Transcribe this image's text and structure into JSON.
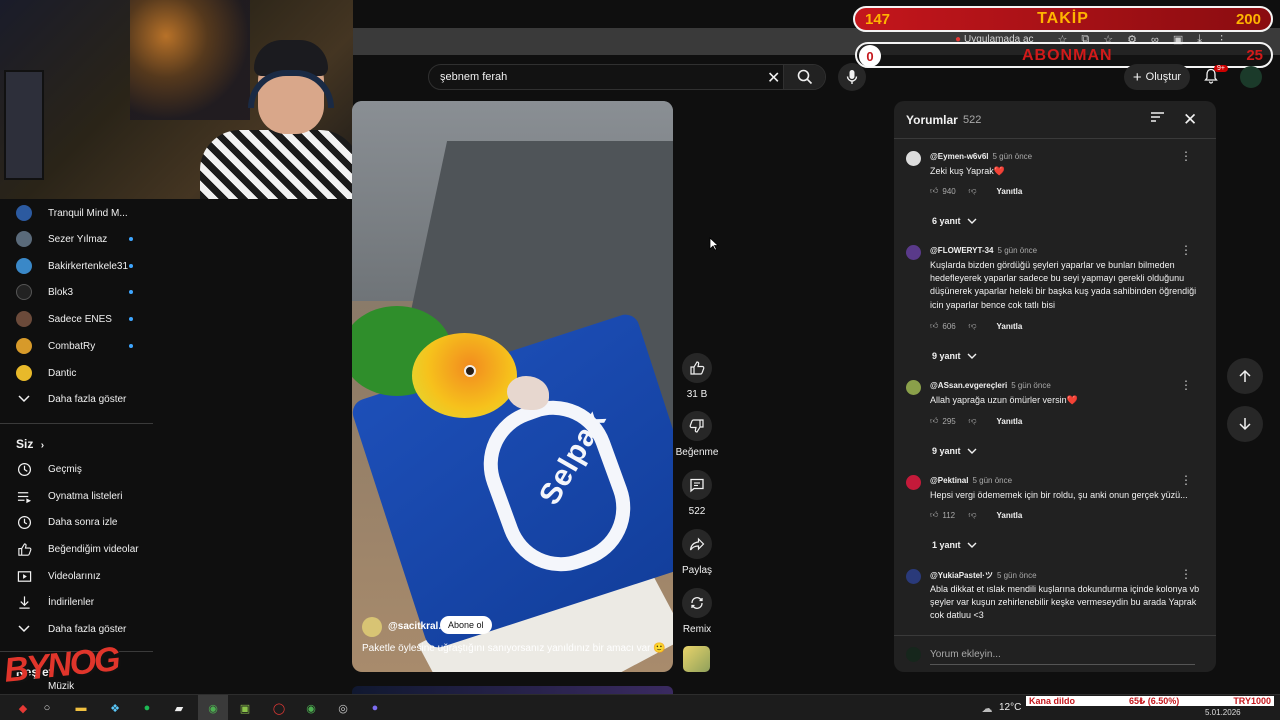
{
  "overlay": {
    "follow_current": "147",
    "follow_label": "TAKİP",
    "follow_goal": "200",
    "sub_current": "0",
    "sub_label": "ABONMAN",
    "sub_goal": "25",
    "logo_text": "BYNOG"
  },
  "browser": {
    "app_open_label": "Uygulamada aç"
  },
  "search": {
    "query": "şebnem ferah"
  },
  "header": {
    "create_label": "Oluştur",
    "notif_count": "9+"
  },
  "sidebar": {
    "subscriptions": [
      {
        "label": "Tranquil Mind M...",
        "color": "#2c5aa0",
        "live": false
      },
      {
        "label": "Sezer Yılmaz",
        "color": "#5a6a7a",
        "live": true
      },
      {
        "label": "Bakirkertenkele31",
        "color": "#3a88c8",
        "live": true
      },
      {
        "label": "Blok3",
        "color": "#222222",
        "live": true
      },
      {
        "label": "Sadece ENES",
        "color": "#6b4a3a",
        "live": true
      },
      {
        "label": "CombatRy",
        "color": "#d79a2a",
        "live": true
      },
      {
        "label": "Dantic",
        "color": "#e8b92a",
        "live": false
      }
    ],
    "show_more_subs": "Daha fazla göster",
    "you_heading": "Siz",
    "you_items": [
      {
        "label": "Geçmiş",
        "icon": "history-icon"
      },
      {
        "label": "Oynatma listeleri",
        "icon": "playlist-icon"
      },
      {
        "label": "Daha sonra izle",
        "icon": "watch-later-icon"
      },
      {
        "label": "Beğendiğim videolar",
        "icon": "like-icon"
      },
      {
        "label": "Videolarınız",
        "icon": "your-videos-icon"
      },
      {
        "label": "İndirilenler",
        "icon": "download-icon"
      }
    ],
    "show_more_you": "Daha fazla göster",
    "explore_heading": "Keşfet",
    "music_label": "Müzik"
  },
  "short": {
    "channel": "@sacitkral.",
    "subscribe_label": "Abone ol",
    "caption": "Paketle öylesine uğraştığını sanıyorsanız yanıldınız bir amacı var 🙂",
    "brand_text": "Selpak"
  },
  "actions": {
    "like_count": "31 B",
    "dislike_label": "Beğenme",
    "comment_count": "522",
    "share_label": "Paylaş",
    "remix_label": "Remix"
  },
  "comments": {
    "title": "Yorumlar",
    "count": "522",
    "reply_label": "Yanıtla",
    "add_placeholder": "Yorum ekleyin...",
    "items": [
      {
        "user": "@Eymen-w6v6l",
        "time": "5 gün önce",
        "text": "Zeki kuş Yaprak❤️",
        "likes": "940",
        "replies": "6 yanıt",
        "avatar_color": "#dcdcdc"
      },
      {
        "user": "@FLOWERYT-34",
        "time": "5 gün önce",
        "text": "Kuşlarda bizden gördüğü şeyleri yaparlar ve bunları bilmeden hedefleyerek yaparlar sadece bu seyi yapmayı gerekli olduğunu düşünerek yaparlar heleki bir başka kuş yada sahibinden öğrendiği icin yaparlar bence cok tatlı bisi",
        "likes": "606",
        "replies": "9 yanıt",
        "avatar_color": "#5a3a8a"
      },
      {
        "user": "@ASsan.evgereçleri",
        "time": "5 gün önce",
        "text": "Allah yaprağa uzun ömürler versin❤️",
        "likes": "295",
        "replies": "9 yanıt",
        "avatar_color": "#8aa04a"
      },
      {
        "user": "@Pektinal",
        "time": "5 gün önce",
        "text": "Hepsi vergi ödememek için bir roldu, şu anki onun gerçek yüzü...",
        "likes": "112",
        "replies": "1 yanıt",
        "avatar_color": "#c41a3a"
      },
      {
        "user": "@YukiaPastel·ツ",
        "time": "5 gün önce",
        "text": "Abla dikkat et ıslak mendili kuşlarına dokundurma içinde kolonya vb şeyler var kuşun zehirlenebilir keşke vermeseydin bu arada Yaprak cok datluu <3",
        "likes": "",
        "replies": "",
        "avatar_color": "#2a3a7a"
      }
    ]
  },
  "taskbar": {
    "temperature": "12°C",
    "ticker_left": "Kana dildo",
    "ticker_mid": "65₺ (6.50%)",
    "ticker_right": "TRY1000",
    "date": "5.01.2026"
  }
}
